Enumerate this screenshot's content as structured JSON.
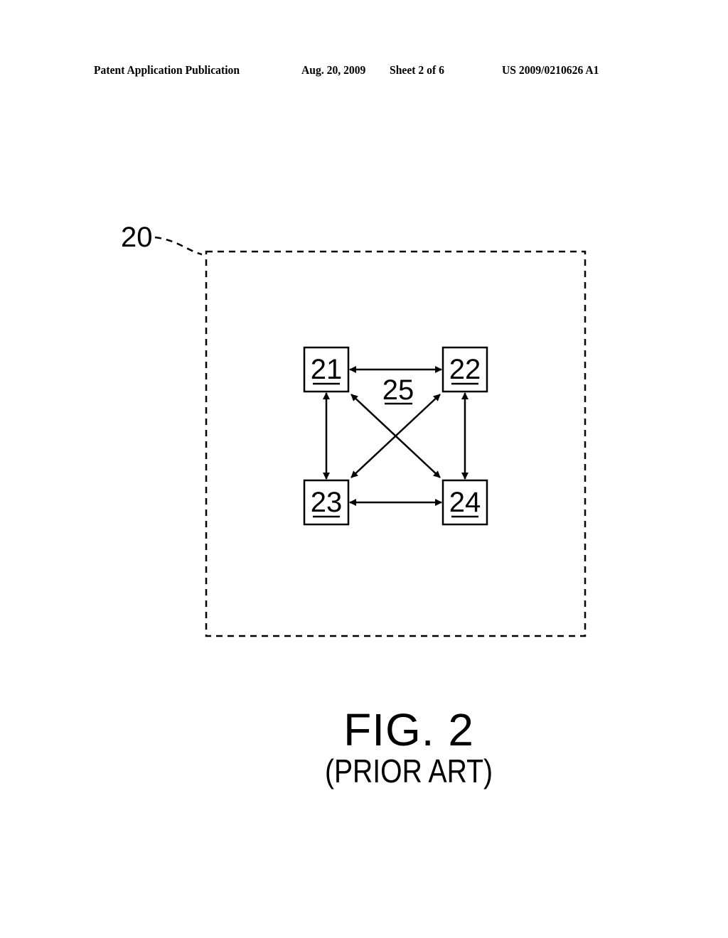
{
  "header": {
    "left": "Patent Application Publication",
    "date": "Aug. 20, 2009",
    "sheet": "Sheet 2 of 6",
    "number": "US 2009/0210626 A1"
  },
  "figure": {
    "title": "FIG. 2",
    "subtitle": "(PRIOR ART)",
    "ref_system": "20",
    "nodes": [
      {
        "id": "21",
        "position": "top-left"
      },
      {
        "id": "22",
        "position": "top-right"
      },
      {
        "id": "23",
        "position": "bottom-left"
      },
      {
        "id": "24",
        "position": "bottom-right"
      }
    ],
    "interconnect_label": "25",
    "connections": [
      {
        "from": "21",
        "to": "22",
        "bidirectional": true
      },
      {
        "from": "21",
        "to": "23",
        "bidirectional": true
      },
      {
        "from": "22",
        "to": "24",
        "bidirectional": true
      },
      {
        "from": "23",
        "to": "24",
        "bidirectional": true
      },
      {
        "from": "21",
        "to": "24",
        "bidirectional": true
      },
      {
        "from": "22",
        "to": "23",
        "bidirectional": true
      }
    ]
  }
}
